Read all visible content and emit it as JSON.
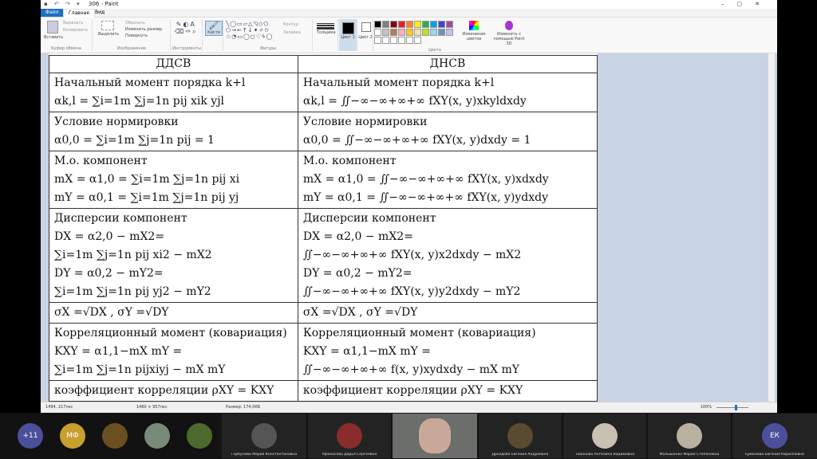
{
  "window": {
    "title": "306 - Paint",
    "controls": [
      "–",
      "▢",
      "✕"
    ]
  },
  "ribbon": {
    "tabs": [
      "Файл",
      "Главная",
      "Вид"
    ],
    "clipboard": {
      "paste": "Вставить",
      "cut": "Вырезать",
      "copy": "Копировать",
      "label": "Буфер обмена"
    },
    "image": {
      "select": "Выделить",
      "crop": "Обрезать",
      "resize": "Изменить размер",
      "rotate": "Повернуть",
      "label": "Изображение"
    },
    "tools_label": "Инструменты",
    "brushes": "Кисти",
    "shapes": {
      "outline": "Контур",
      "fill": "Заливка",
      "label": "Фигуры"
    },
    "size": "Толщина",
    "color1": "Цвет 1",
    "color2": "Цвет 2",
    "edit_colors": "Изменение цветов",
    "paint3d": "Изменить с помощью Paint 3D",
    "colors_label": "Цвета",
    "palette": [
      "#000000",
      "#7f7f7f",
      "#880015",
      "#ed1c24",
      "#ff7f27",
      "#fff200",
      "#22b14c",
      "#00a2e8",
      "#3f48cc",
      "#a349a4",
      "#ffffff",
      "#c3c3c3",
      "#b97a57",
      "#ffaec9",
      "#ffc90e",
      "#efe4b0",
      "#b5e61d",
      "#99d9ea",
      "#7092be",
      "#c8bfe7"
    ]
  },
  "document": {
    "headers": [
      "ДДСВ",
      "ДНСВ"
    ],
    "rows": [
      {
        "left": [
          "Начальный момент порядка k+l",
          "αk,l = ∑i=1m ∑j=1n pij xik yjl"
        ],
        "right": [
          "Начальный момент порядка k+l",
          "αk,l = ∬−∞−∞+∞+∞ fXY(x, y)xkyldxdy"
        ]
      },
      {
        "left": [
          "Условие нормировки",
          "α0,0 = ∑i=1m ∑j=1n pij = 1"
        ],
        "right": [
          "Условие нормировки",
          "α0,0 = ∬−∞−∞+∞+∞ fXY(x, y)dxdy = 1"
        ]
      },
      {
        "left": [
          "М.о. компонент",
          "mX = α1,0 = ∑i=1m ∑j=1n pij xi",
          "mY = α0,1 = ∑i=1m ∑j=1n pij yj"
        ],
        "right": [
          "М.о. компонент",
          "mX = α1,0 = ∬−∞−∞+∞+∞ fXY(x, y)xdxdy",
          "mY = α0,1 = ∬−∞−∞+∞+∞ fXY(x, y)ydxdy"
        ]
      },
      {
        "left": [
          "Дисперсии компонент",
          "DX = α2,0 − mX2=",
          "∑i=1m ∑j=1n pij xi2 − mX2",
          "DY = α0,2 − mY2=",
          "∑i=1m ∑j=1n pij yj2 − mY2"
        ],
        "right": [
          "Дисперсии компонент",
          "DX = α2,0 − mX2=",
          "∬−∞−∞+∞+∞ fXY(x, y)x2dxdy − mX2",
          "DY = α0,2 − mY2=",
          "∬−∞−∞+∞+∞ fXY(x, y)y2dxdy − mY2"
        ]
      },
      {
        "left": [
          "σX =√DX , σY =√DY"
        ],
        "right": [
          "σX =√DX , σY =√DY"
        ]
      },
      {
        "left": [
          "Корреляционный момент (ковариация)",
          "KXY = α1,1−mX mY =",
          "∑i=1m ∑j=1n pijxiyj − mX mY"
        ],
        "right": [
          "Корреляционный момент (ковариация)",
          "KXY = α1,1−mX mY =",
          "∬−∞−∞+∞+∞ f(x, y)xydxdy − mX mY"
        ]
      },
      {
        "left": [
          "коэффициент корреляции ρXY = KXY"
        ],
        "right": [
          "коэффициент корреляции ρXY = KXY"
        ]
      }
    ]
  },
  "statusbar": {
    "cursor": "1494, 217пкс",
    "selection": "1460 × 957пкс",
    "size": "Размер: 174,0КБ",
    "zoom": "100%"
  },
  "participants": {
    "more": "+11",
    "initials_mf": "МФ",
    "initials_ek": "ЕК",
    "names": [
      "Горбунова Мария Константиновна",
      "Афанасова Дарья Сергеевна",
      "Дроздова Евгения Андреевна",
      "Тихонова Ангелина Вадимовна",
      "Малышенко Мария Степановна",
      "Ермилова Евгения Кирилловна"
    ]
  },
  "colors": {
    "accent": "#1e6fbf",
    "canvas_bg": "#c8d3e3",
    "video_bg": "#121212"
  }
}
